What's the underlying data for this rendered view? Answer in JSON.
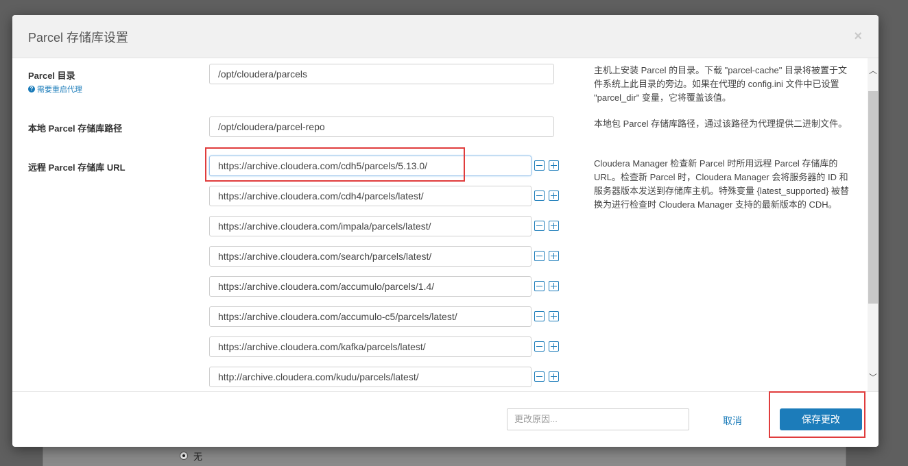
{
  "modal": {
    "title": "Parcel 存储库设置",
    "close_glyph": "×"
  },
  "fields": {
    "parcel_dir": {
      "label": "Parcel 目录",
      "restart_hint": "需要重启代理",
      "value": "/opt/cloudera/parcels",
      "description": "主机上安装 Parcel 的目录。下载 \"parcel-cache\" 目录将被置于文件系统上此目录的旁边。如果在代理的 config.ini 文件中已设置 \"parcel_dir\" 变量，它将覆盖该值。"
    },
    "local_repo": {
      "label": "本地 Parcel 存储库路径",
      "value": "/opt/cloudera/parcel-repo",
      "description": "本地包 Parcel 存储库路径，通过该路径为代理提供二进制文件。"
    },
    "remote_urls": {
      "label": "远程 Parcel 存储库 URL",
      "description": "Cloudera Manager 检查新 Parcel 时所用远程 Parcel 存储库的 URL。检查新 Parcel 时，Cloudera Manager 会将服务器的 ID 和服务器版本发送到存储库主机。特殊变量 {latest_supported} 被替换为进行检查时 Cloudera Manager 支持的最新版本的 CDH。",
      "values": [
        "https://archive.cloudera.com/cdh5/parcels/5.13.0/",
        "https://archive.cloudera.com/cdh4/parcels/latest/",
        "https://archive.cloudera.com/impala/parcels/latest/",
        "https://archive.cloudera.com/search/parcels/latest/",
        "https://archive.cloudera.com/accumulo/parcels/1.4/",
        "https://archive.cloudera.com/accumulo-c5/parcels/latest/",
        "https://archive.cloudera.com/kafka/parcels/latest/",
        "http://archive.cloudera.com/kudu/parcels/latest/"
      ]
    }
  },
  "scrollbar": {
    "up_glyph": "︿",
    "down_glyph": "﹀"
  },
  "footer": {
    "reason_placeholder": "更改原因...",
    "cancel_label": "取消",
    "save_label": "保存更改"
  },
  "background": {
    "radio_label": "无"
  },
  "colors": {
    "accent": "#1c7cba",
    "highlight": "#e03c3c"
  },
  "icons": [
    "close-icon",
    "help-icon",
    "minus-icon",
    "plus-icon",
    "chevron-up-icon",
    "chevron-down-icon"
  ]
}
